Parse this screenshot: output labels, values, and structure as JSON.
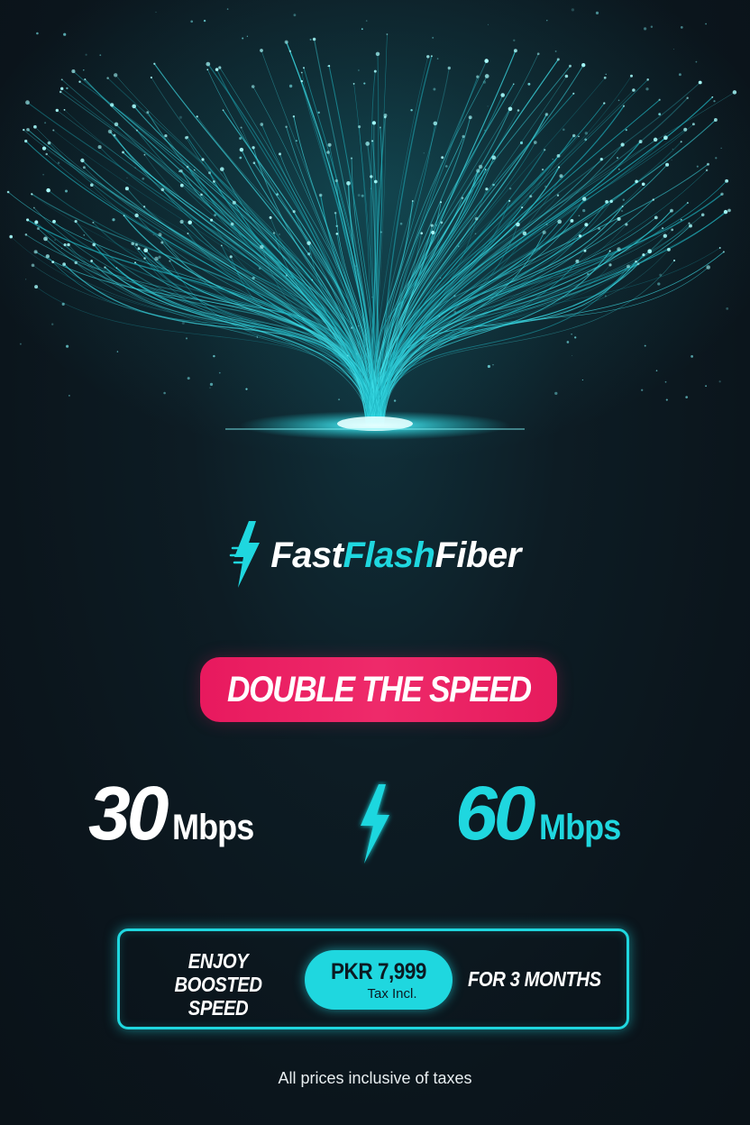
{
  "brand": {
    "name_part1": "Fast",
    "name_part2": "Flash",
    "name_part3": "Fiber",
    "logo_icon": "lightning-bolt-icon",
    "accent_color": "#1fd7df",
    "highlight_color": "#e8195e"
  },
  "headline": "DOUBLE THE SPEED",
  "speeds": {
    "old_value": "30",
    "old_unit": "Mbps",
    "new_value": "60",
    "new_unit": "Mbps",
    "separator_icon": "lightning-bolt-icon"
  },
  "offer": {
    "line1": "ENJOY",
    "line2": "BOOSTED SPEED",
    "price": "PKR 7,999",
    "price_note": "Tax Incl.",
    "duration": "FOR 3 MONTHS"
  },
  "footnote": "All prices inclusive of taxes"
}
